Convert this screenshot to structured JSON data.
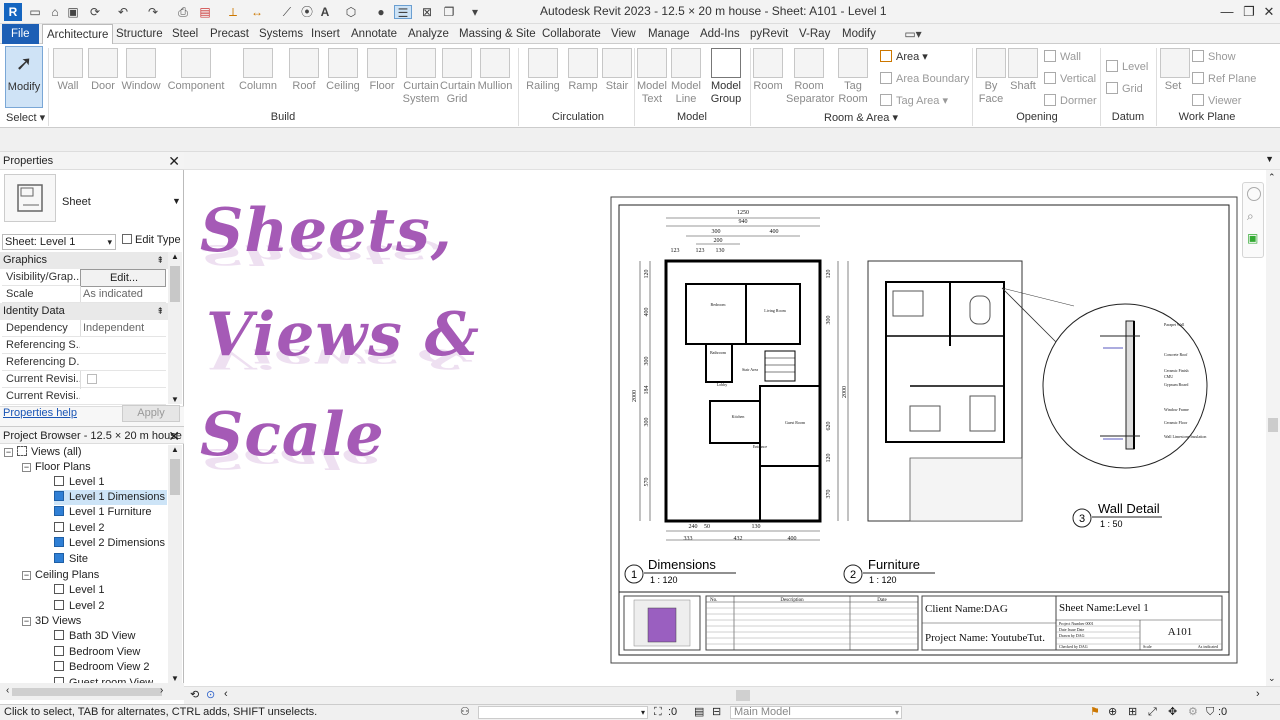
{
  "window": {
    "app_letter": "R",
    "title": "Autodesk Revit 2023 - 12.5 × 20 m house - Sheet: A101 - Level 1"
  },
  "menu": {
    "tabs": [
      "File",
      "Architecture",
      "Structure",
      "Steel",
      "Precast",
      "Systems",
      "Insert",
      "Annotate",
      "Analyze",
      "Massing & Site",
      "Collaborate",
      "View",
      "Manage",
      "Add-Ins",
      "pyRevit",
      "V-Ray",
      "Modify"
    ],
    "active": "Architecture"
  },
  "ribbon": {
    "select_label": "Select",
    "modify": "Modify",
    "build": {
      "label": "Build",
      "buttons": [
        "Wall",
        "Door",
        "Window",
        "Component",
        "Column",
        "Roof",
        "Ceiling",
        "Floor",
        "Curtain System",
        "Curtain Grid",
        "Mullion"
      ]
    },
    "circulation": {
      "label": "Circulation",
      "buttons": [
        "Railing",
        "Ramp",
        "Stair"
      ]
    },
    "model": {
      "label": "Model",
      "buttons": [
        "Model Text",
        "Model Line",
        "Model Group"
      ]
    },
    "room_area": {
      "label": "Room & Area",
      "buttons": [
        "Room",
        "Room Separator",
        "Tag Room"
      ],
      "small": [
        "Area",
        "Area  Boundary",
        "Tag  Area"
      ]
    },
    "opening": {
      "label": "Opening",
      "buttons": [
        "By Face",
        "Shaft"
      ],
      "small": [
        "Wall",
        "Vertical",
        "Dormer"
      ]
    },
    "datum": {
      "label": "Datum",
      "small": [
        "Level",
        "Grid"
      ]
    },
    "work_plane": {
      "label": "Work Plane",
      "buttons": [
        "Set"
      ],
      "small": [
        "Show",
        "Ref  Plane",
        "Viewer"
      ]
    }
  },
  "properties": {
    "title": "Properties",
    "type_name": "Sheet",
    "selector": "Sheet: Level 1",
    "edit_type": "Edit Type",
    "sections": [
      {
        "name": "Graphics",
        "rows": [
          {
            "key": "Visibility/Grap...",
            "value": "Edit..."
          },
          {
            "key": "Scale",
            "value": "As indicated"
          }
        ]
      },
      {
        "name": "Identity Data",
        "rows": [
          {
            "key": "Dependency",
            "value": "Independent"
          },
          {
            "key": "Referencing S...",
            "value": ""
          },
          {
            "key": "Referencing D...",
            "value": ""
          },
          {
            "key": "Current Revisi...",
            "value": ""
          },
          {
            "key": "Current Revisi...",
            "value": ""
          }
        ]
      }
    ],
    "help_link": "Properties help",
    "apply": "Apply"
  },
  "browser": {
    "title": "Project Browser - 12.5 × 20 m house",
    "root": "Views (all)",
    "groups": [
      {
        "name": "Floor Plans",
        "items": [
          "Level 1",
          "Level 1 Dimensions",
          "Level 1 Furniture",
          "Level 2",
          "Level 2 Dimensions",
          "Site"
        ],
        "blue": [
          1,
          2,
          4,
          5
        ],
        "selected": 1
      },
      {
        "name": "Ceiling Plans",
        "items": [
          "Level 1",
          "Level 2"
        ],
        "blue": []
      },
      {
        "name": "3D Views",
        "items": [
          "Bath 3D View",
          "Bedroom View",
          "Bedroom View 2",
          "Guest room View"
        ],
        "blue": []
      }
    ]
  },
  "overlay": {
    "line1": "Sheets,",
    "line2": "Views &",
    "line3": "Scale",
    "color": "#a55ab6"
  },
  "sheet": {
    "views": [
      {
        "number": "1",
        "name": "Dimensions",
        "scale": "1 : 120"
      },
      {
        "number": "2",
        "name": "Furniture",
        "scale": "1 : 120"
      },
      {
        "number": "3",
        "name": "Wall Detail",
        "scale": "1 : 50"
      }
    ],
    "title_block": {
      "client": "Client Name:DAG",
      "project": "Project Name: YoutubeTut.",
      "sheet_name": "Sheet Name:Level 1",
      "sheet_number": "A101",
      "rev_headers": [
        "No.",
        "Description",
        "Date"
      ],
      "small_rows": [
        "Project Number 0001",
        "Date Issue Date",
        "Drawn by DAG",
        "Checked by DAG"
      ],
      "scale_label": "Scale",
      "scale_value": "As indicated"
    },
    "dims_top": [
      "1250",
      "940",
      "300",
      "400",
      "200",
      "130",
      "123",
      "123"
    ],
    "dims_bottom": [
      "240",
      "50",
      "130",
      "333",
      "432",
      "400"
    ],
    "dims_left": [
      "2000",
      "120",
      "400",
      "300",
      "184",
      "300",
      "570"
    ],
    "dims_right": [
      "2000",
      "120",
      "300",
      "620",
      "120",
      "370"
    ],
    "rooms": [
      "Bedroom",
      "Living Room",
      "Bathroom",
      "Stair Area",
      "Lobby",
      "Kitchen",
      "Guest Room",
      "Entrance"
    ],
    "detail_labels": [
      "Parapet Wall",
      "Concrete Roof",
      "Ceramic Finish",
      "CMU",
      "Gypsum Board",
      "Window Frame",
      "Ceramic Floor",
      "Wall Limestone Insulation"
    ]
  },
  "status": {
    "message": "Click to select, TAB for alternates, CTRL adds, SHIFT unselects.",
    "count_a": ":0",
    "model": "Main Model",
    "count_b": ":0"
  }
}
